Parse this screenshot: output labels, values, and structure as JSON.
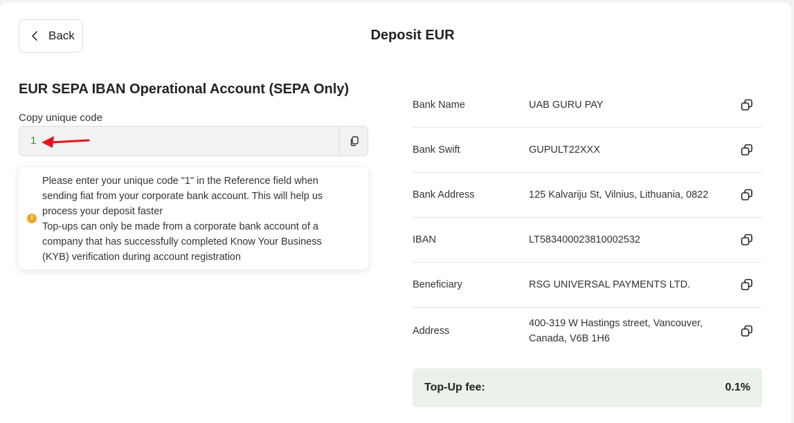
{
  "header": {
    "back_label": "Back",
    "title": "Deposit EUR"
  },
  "account": {
    "title": "EUR SEPA IBAN Operational Account (SEPA Only)",
    "code_label": "Copy unique code",
    "code_value": "1"
  },
  "notice": {
    "line1": "Please enter your unique code \"1\" in the Reference field when sending fiat from your corporate bank account. This will help us process your deposit faster",
    "line2": "Top-ups can only be made from a corporate bank account of a company that has successfully completed Know Your Business (KYB) verification during account registration",
    "icon": "warning-icon",
    "icon_color": "#f5a623"
  },
  "bank_details": [
    {
      "label": "Bank Name",
      "value": "UAB GURU PAY"
    },
    {
      "label": "Bank Swift",
      "value": "GUPULT22XXX"
    },
    {
      "label": "Bank Address",
      "value": "125 Kalvariju St, Vilnius, Lithuania, 0822"
    },
    {
      "label": "IBAN",
      "value": "LT583400023810002532"
    },
    {
      "label": "Beneficiary",
      "value": "RSG UNIVERSAL PAYMENTS LTD."
    },
    {
      "label": "Address",
      "value": "400-319 W Hastings street, Vancouver, Canada, V6B 1H6"
    }
  ],
  "fee": {
    "label": "Top-Up fee:",
    "value": "0.1%"
  },
  "colors": {
    "code_text": "#3f8a3f",
    "fee_bg": "#e9f1e9",
    "arrow": "#e0161b"
  }
}
